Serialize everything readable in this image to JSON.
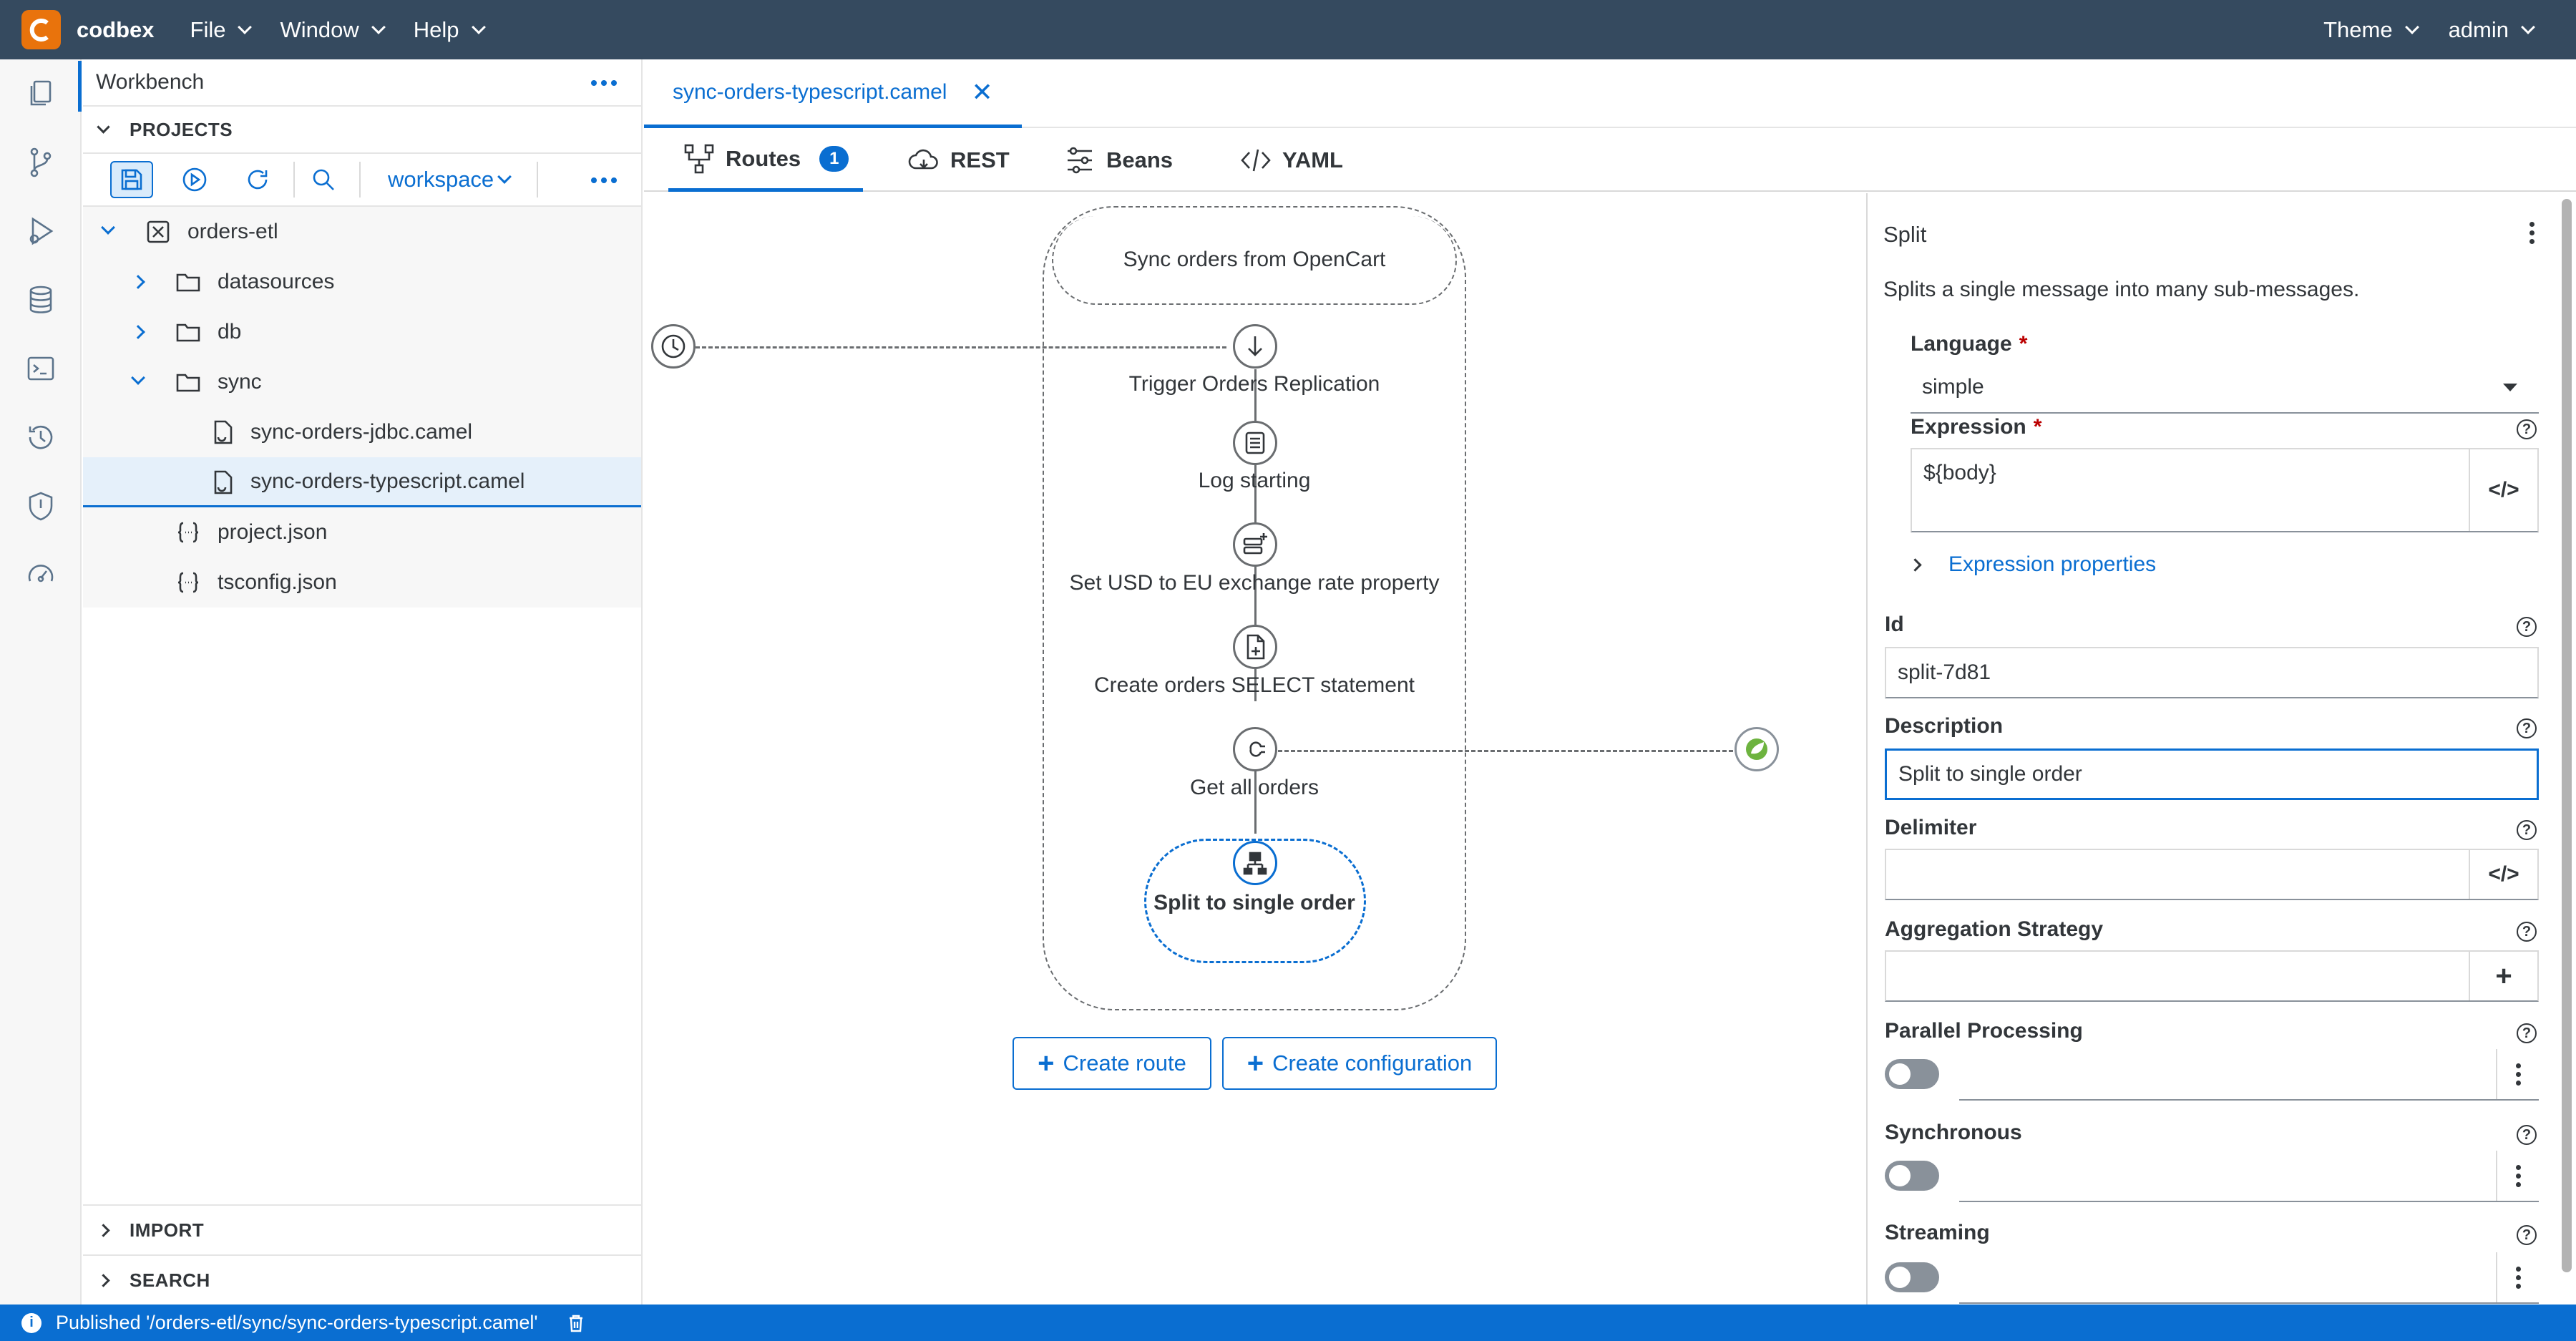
{
  "app": {
    "brand": "codbex",
    "menus": [
      "File",
      "Window",
      "Help"
    ],
    "theme_label": "Theme",
    "user_label": "admin"
  },
  "explorer": {
    "title": "Workbench",
    "projects_label": "PROJECTS",
    "workspace_label": "workspace",
    "tree": [
      {
        "label": "orders-etl"
      },
      {
        "label": "datasources"
      },
      {
        "label": "db"
      },
      {
        "label": "sync"
      },
      {
        "label": "sync-orders-jdbc.camel"
      },
      {
        "label": "sync-orders-typescript.camel"
      },
      {
        "label": "project.json"
      },
      {
        "label": "tsconfig.json"
      }
    ],
    "import_label": "IMPORT",
    "search_label": "SEARCH"
  },
  "editor": {
    "tab_label": "sync-orders-typescript.camel",
    "close_glyph": "✕",
    "subtabs": {
      "routes": "Routes",
      "routes_count": "1",
      "rest": "REST",
      "beans": "Beans",
      "yaml": "YAML"
    }
  },
  "route": {
    "title": "Sync orders from OpenCart",
    "steps": [
      {
        "label": "Trigger Orders Replication",
        "icon": "arrow-down-icon"
      },
      {
        "label": "Log starting",
        "icon": "log-icon"
      },
      {
        "label": "Set USD to EU exchange rate property",
        "icon": "set-property-icon"
      },
      {
        "label": "Create orders SELECT statement",
        "icon": "file-plus-icon"
      },
      {
        "label": "Get all orders",
        "icon": "plug-icon"
      },
      {
        "label": "Split to single order",
        "icon": "split-icon"
      }
    ],
    "create_route": "Create route",
    "create_configuration": "Create configuration"
  },
  "properties": {
    "title": "Split",
    "description": "Splits a single message into many sub-messages.",
    "language_label": "Language",
    "language_value": "simple",
    "expression_label": "Expression",
    "expression_value": "${body}",
    "expression_props_label": "Expression properties",
    "id_label": "Id",
    "id_value": "split-7d81",
    "description_label": "Description",
    "description_value": "Split to single order",
    "delimiter_label": "Delimiter",
    "aggregation_label": "Aggregation Strategy",
    "parallel_label": "Parallel Processing",
    "synchronous_label": "Synchronous",
    "streaming_label": "Streaming",
    "required_mark": "*",
    "help_glyph": "?",
    "code_glyph": "</>",
    "plus_glyph": "+"
  },
  "status": {
    "message": "Published '/orders-etl/sync/sync-orders-typescript.camel'",
    "info_glyph": "i"
  },
  "colors": {
    "topbar": "#354a5f",
    "accent": "#0a6ed1",
    "logo": "#e9730c"
  }
}
